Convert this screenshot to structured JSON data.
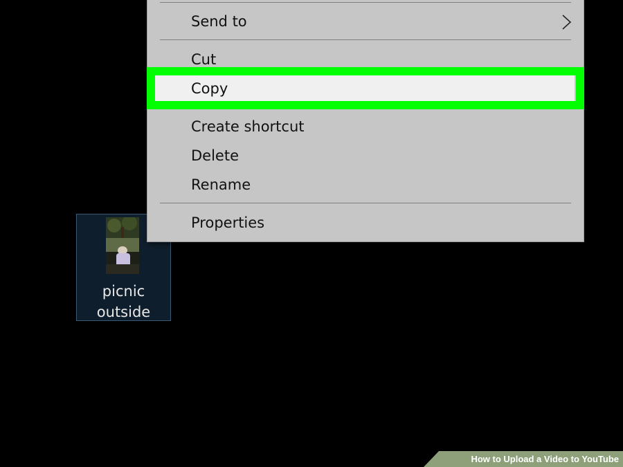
{
  "desktop": {
    "file": {
      "name_line1": "picnic",
      "name_line2": "outside",
      "thumbnail_icon": "video-thumbnail-icon"
    }
  },
  "context_menu": {
    "items": [
      {
        "label": "Send to",
        "has_submenu": true,
        "submenu_icon": "chevron-right-icon"
      },
      {
        "label": "Cut"
      },
      {
        "label": "Copy",
        "highlighted": true
      },
      {
        "label": "Create shortcut"
      },
      {
        "label": "Delete"
      },
      {
        "label": "Rename"
      },
      {
        "label": "Properties"
      }
    ],
    "highlight_color": "#00ff00",
    "background_color": "#c6c6c6"
  },
  "watermark": {
    "text": "How to Upload a Video to YouTube"
  }
}
